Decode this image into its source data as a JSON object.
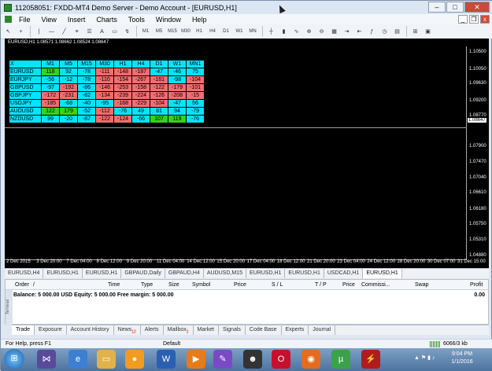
{
  "window": {
    "title": "112058051: FXDD-MT4 Demo Server - Demo Account - [EURUSD,H1]",
    "minimize": "–",
    "maximize": "□",
    "close": "✕"
  },
  "menu": [
    "File",
    "View",
    "Insert",
    "Charts",
    "Tools",
    "Window",
    "Help"
  ],
  "mdi": {
    "minimize": "_",
    "restore": "❐",
    "close": "x"
  },
  "toolbar": {
    "timeframes": [
      "M1",
      "M5",
      "M15",
      "M30",
      "H1",
      "H4",
      "D1",
      "W1",
      "MN"
    ]
  },
  "chart": {
    "info": "EURUSD,H1  1.08571 1.08662 1.08524 1.08647",
    "y_labels": [
      "1.10500",
      "1.10050",
      "1.09630",
      "1.09200",
      "1.08770",
      "1.08647",
      "1.07900",
      "1.07470",
      "1.07040",
      "1.06610",
      "1.06180",
      "1.05750",
      "1.05310",
      "1.04880"
    ],
    "current_price": "1.08647",
    "x_labels": [
      "2 Dec 2015",
      "3 Dec 20:00",
      "7 Dec 04:00",
      "8 Dec 12:00",
      "9 Dec 20:00",
      "11 Dec 04:00",
      "14 Dec 12:00",
      "15 Dec 20:00",
      "17 Dec 04:00",
      "18 Dec 12:00",
      "21 Dec 20:00",
      "23 Dec 04:00",
      "24 Dec 12:00",
      "28 Dec 20:00",
      "30 Dec 07:00",
      "31 Dec 15:00"
    ],
    "grid": {
      "header": [
        "X",
        "M1",
        "M5",
        "M15",
        "M30",
        "H1",
        "H4",
        "D1",
        "W1",
        "MN1"
      ],
      "rows": [
        {
          "pair": "EURUSD",
          "cells": [
            {
              "v": "118",
              "c": "green"
            },
            {
              "v": "92",
              "c": "cyan"
            },
            {
              "v": "-78",
              "c": "cyan"
            },
            {
              "v": "-111",
              "c": "red"
            },
            {
              "v": "-148",
              "c": "red"
            },
            {
              "v": "-187",
              "c": "red"
            },
            {
              "v": "-47",
              "c": "cyan"
            },
            {
              "v": "-46",
              "c": "cyan"
            },
            {
              "v": "75",
              "c": "cyan"
            }
          ]
        },
        {
          "pair": "EURJPY",
          "cells": [
            {
              "v": "-56",
              "c": "cyan"
            },
            {
              "v": "-12",
              "c": "cyan"
            },
            {
              "v": "-78",
              "c": "cyan"
            },
            {
              "v": "-110",
              "c": "red"
            },
            {
              "v": "-154",
              "c": "red"
            },
            {
              "v": "-267",
              "c": "red"
            },
            {
              "v": "-161",
              "c": "red"
            },
            {
              "v": "-98",
              "c": "cyan"
            },
            {
              "v": "-104",
              "c": "red"
            }
          ]
        },
        {
          "pair": "GBPUSD",
          "cells": [
            {
              "v": "-97",
              "c": "cyan"
            },
            {
              "v": "-192",
              "c": "red"
            },
            {
              "v": "-86",
              "c": "cyan"
            },
            {
              "v": "-146",
              "c": "red"
            },
            {
              "v": "-253",
              "c": "red"
            },
            {
              "v": "-158",
              "c": "red"
            },
            {
              "v": "-122",
              "c": "red"
            },
            {
              "v": "-179",
              "c": "red"
            },
            {
              "v": "-101",
              "c": "red"
            }
          ]
        },
        {
          "pair": "GBPJPY",
          "cells": [
            {
              "v": "-172",
              "c": "red"
            },
            {
              "v": "-231",
              "c": "red"
            },
            {
              "v": "-82",
              "c": "cyan"
            },
            {
              "v": "-134",
              "c": "red"
            },
            {
              "v": "-239",
              "c": "red"
            },
            {
              "v": "-224",
              "c": "red"
            },
            {
              "v": "-126",
              "c": "red"
            },
            {
              "v": "-208",
              "c": "red"
            },
            {
              "v": "-15",
              "c": "red"
            }
          ]
        },
        {
          "pair": "USDJPY",
          "cells": [
            {
              "v": "-185",
              "c": "red"
            },
            {
              "v": "-68",
              "c": "cyan"
            },
            {
              "v": "-40",
              "c": "cyan"
            },
            {
              "v": "-95",
              "c": "cyan"
            },
            {
              "v": "-168",
              "c": "red"
            },
            {
              "v": "-229",
              "c": "red"
            },
            {
              "v": "-104",
              "c": "red"
            },
            {
              "v": "-47",
              "c": "cyan"
            },
            {
              "v": "56",
              "c": "cyan"
            }
          ]
        },
        {
          "pair": "AUDUSD",
          "cells": [
            {
              "v": "122",
              "c": "green"
            },
            {
              "v": "179",
              "c": "green"
            },
            {
              "v": "-52",
              "c": "cyan"
            },
            {
              "v": "-112",
              "c": "red"
            },
            {
              "v": "-76",
              "c": "cyan"
            },
            {
              "v": "49",
              "c": "cyan"
            },
            {
              "v": "81",
              "c": "cyan"
            },
            {
              "v": "94",
              "c": "cyan"
            },
            {
              "v": "-79",
              "c": "cyan"
            }
          ]
        },
        {
          "pair": "NZDUSD",
          "cells": [
            {
              "v": "99",
              "c": "cyan"
            },
            {
              "v": "-20",
              "c": "cyan"
            },
            {
              "v": "-87",
              "c": "cyan"
            },
            {
              "v": "-122",
              "c": "red"
            },
            {
              "v": "-124",
              "c": "red"
            },
            {
              "v": "-66",
              "c": "cyan"
            },
            {
              "v": "107",
              "c": "green"
            },
            {
              "v": "119",
              "c": "green"
            },
            {
              "v": "-76",
              "c": "cyan"
            }
          ]
        }
      ]
    }
  },
  "chart_tabs": [
    "EURUSD,H4",
    "EURUSD,H1",
    "EURUSD,H1",
    "GBPAUD,Daily",
    "GBPAUD,H4",
    "AUDUSD,M15",
    "EURUSD,H1",
    "EURUSD,H1",
    "USDCAD,H1",
    "EURUSD,H1"
  ],
  "active_chart_tab": 9,
  "terminal": {
    "columns": [
      "Order",
      "/",
      "Time",
      "Type",
      "Size",
      "Symbol",
      "Price",
      "S / L",
      "T / P",
      "Price",
      "Commissi...",
      "Swap",
      "Profit"
    ],
    "balance_line": "Balance: 5 000.00 USD  Equity: 5 000.00  Free margin: 5 000.00",
    "balance_profit": "0.00",
    "side_label": "Terminal"
  },
  "terminal_tabs": [
    {
      "label": "Trade",
      "badge": ""
    },
    {
      "label": "Exposure",
      "badge": ""
    },
    {
      "label": "Account History",
      "badge": ""
    },
    {
      "label": "News",
      "badge": "12"
    },
    {
      "label": "Alerts",
      "badge": ""
    },
    {
      "label": "Mailbox",
      "badge": "2"
    },
    {
      "label": "Market",
      "badge": ""
    },
    {
      "label": "Signals",
      "badge": ""
    },
    {
      "label": "Code Base",
      "badge": ""
    },
    {
      "label": "Experts",
      "badge": ""
    },
    {
      "label": "Journal",
      "badge": ""
    }
  ],
  "status": {
    "help": "For Help, press F1",
    "profile": "Default",
    "traffic": "6066/3 kb"
  },
  "taskbar": {
    "time": "9:04 PM",
    "date": "1/1/2016"
  }
}
